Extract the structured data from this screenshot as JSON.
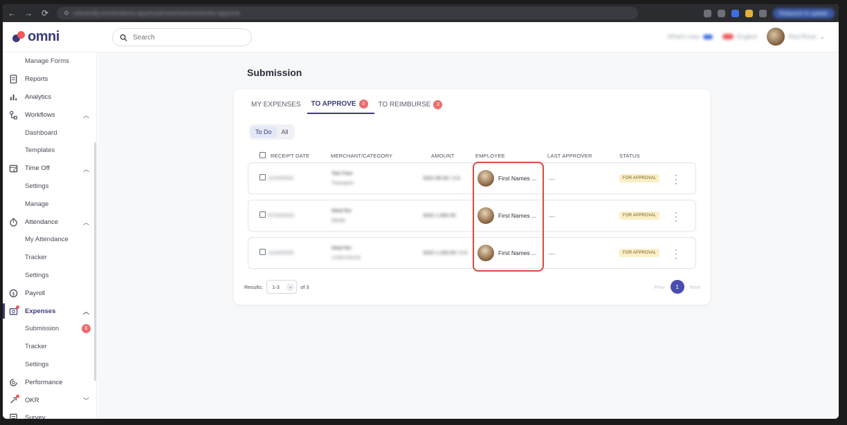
{
  "browser": {
    "url": "rebrandly.omnihrdemo.app/expenses/submission/to-approve",
    "action_button": "Relaunch to update"
  },
  "header": {
    "logo": "omni",
    "search_placeholder": "Search",
    "whats_new": "What's new",
    "help_label": "English",
    "user_name": "Red Rose"
  },
  "sidebar": {
    "items": [
      {
        "label": "Manage Forms",
        "level": "sub"
      },
      {
        "label": "Reports",
        "level": "top",
        "icon": "document-icon"
      },
      {
        "label": "Analytics",
        "level": "top",
        "icon": "bar-chart-icon"
      },
      {
        "label": "Workflows",
        "level": "top",
        "icon": "workflow-icon",
        "expanded": true
      },
      {
        "label": "Dashboard",
        "level": "sub"
      },
      {
        "label": "Templates",
        "level": "sub"
      },
      {
        "label": "Time Off",
        "level": "top",
        "icon": "calendar-icon",
        "expanded": true
      },
      {
        "label": "Settings",
        "level": "sub"
      },
      {
        "label": "Manage",
        "level": "sub"
      },
      {
        "label": "Attendance",
        "level": "top",
        "icon": "stopwatch-icon",
        "expanded": true
      },
      {
        "label": "My Attendance",
        "level": "sub"
      },
      {
        "label": "Tracker",
        "level": "sub"
      },
      {
        "label": "Settings",
        "level": "sub"
      },
      {
        "label": "Payroll",
        "level": "top",
        "icon": "dollar-icon"
      },
      {
        "label": "Expenses",
        "level": "top",
        "icon": "expenses-icon",
        "expanded": true,
        "active": true
      },
      {
        "label": "Submission",
        "level": "sub",
        "badge": "6"
      },
      {
        "label": "Tracker",
        "level": "sub"
      },
      {
        "label": "Settings",
        "level": "sub"
      },
      {
        "label": "Performance",
        "level": "top",
        "icon": "performance-icon"
      },
      {
        "label": "OKR",
        "level": "top",
        "icon": "rocket-icon",
        "collapsed": true
      },
      {
        "label": "Survey",
        "level": "top",
        "icon": "survey-icon"
      }
    ]
  },
  "main": {
    "title": "Submission",
    "tabs": [
      {
        "label": "MY EXPENSES"
      },
      {
        "label": "TO APPROVE",
        "badge": "3",
        "active": true
      },
      {
        "label": "TO REIMBURSE",
        "badge": "3"
      }
    ],
    "filters": {
      "todo": "To Do",
      "all": "All"
    },
    "columns": {
      "receipt_date": "RECEIPT DATE",
      "merchant": "MERCHANT/CATEGORY",
      "amount": "AMOUNT",
      "employee": "EMPLOYEE",
      "last_approver": "LAST APPROVER",
      "status": "STATUS"
    },
    "rows": [
      {
        "date": "11/10/2023",
        "merchant": "Taxi Fare",
        "category": "Transport",
        "amount": "SGD 85.00 / 2.0",
        "employee": "First Names ...",
        "last_approver": "—",
        "status": "FOR APPROVAL"
      },
      {
        "date": "07/10/2023",
        "merchant": "Meal fee",
        "category": "Meals",
        "amount": "SGD 1,000.00",
        "employee": "First Names ...",
        "last_approver": "—",
        "status": "FOR APPROVAL"
      },
      {
        "date": "11/10/2023",
        "merchant": "Meal fee",
        "category": "1230123123",
        "amount": "SGD 1,100.00 / 2.0",
        "employee": "First Names ...",
        "last_approver": "—",
        "status": "FOR APPROVAL"
      }
    ],
    "footer": {
      "results_label": "Results:",
      "range": "1-3",
      "of_total": "of 3",
      "prev": "Prev",
      "current_page": "1",
      "next": "Next"
    }
  }
}
